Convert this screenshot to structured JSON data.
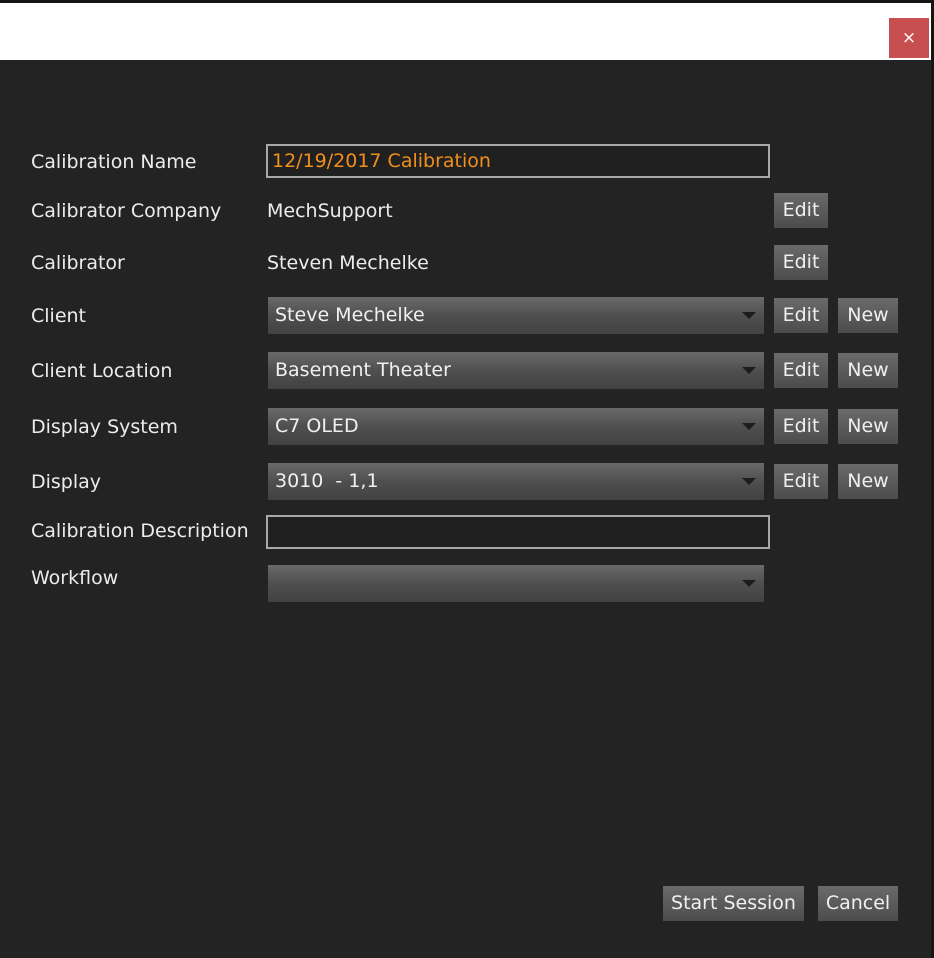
{
  "window": {
    "close_glyph": "×"
  },
  "form": {
    "calibration_name": {
      "label": "Calibration Name",
      "value": "12/19/2017 Calibration"
    },
    "calibrator_company": {
      "label": "Calibrator Company",
      "value": "MechSupport"
    },
    "calibrator": {
      "label": "Calibrator",
      "value": "Steven Mechelke"
    },
    "client": {
      "label": "Client",
      "selected": "Steve Mechelke"
    },
    "client_location": {
      "label": "Client Location",
      "selected": "Basement Theater"
    },
    "display_system": {
      "label": "Display System",
      "selected": "C7 OLED"
    },
    "display": {
      "label": "Display",
      "selected": "3010  - 1,1"
    },
    "calibration_description": {
      "label": "Calibration Description",
      "value": ""
    },
    "workflow": {
      "label": "Workflow",
      "selected": ""
    }
  },
  "buttons": {
    "edit": "Edit",
    "new": "New",
    "start_session": "Start Session",
    "cancel": "Cancel"
  },
  "colors": {
    "accent_text": "#f0901a",
    "close_button": "#c84f4f",
    "background": "#232323"
  },
  "icons": {
    "close": "close-icon",
    "dropdown": "chevron-down-icon"
  }
}
